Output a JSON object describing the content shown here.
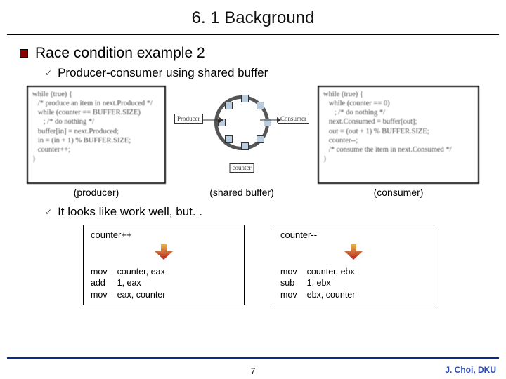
{
  "title": "6. 1 Background",
  "heading": "Race condition example 2",
  "sub1": "Producer-consumer using shared buffer",
  "producer_code": "while (true) {\n   /* produce an item in next.Produced */\n   while (counter == BUFFER.SIZE)\n      ; /* do nothing */\n   buffer[in] = next.Produced;\n   in = (in + 1) % BUFFER.SIZE;\n   counter++;\n}",
  "consumer_code": "while (true) {\n   while (counter == 0)\n      ; /* do nothing */\n   next.Consumed = buffer[out];\n   out = (out + 1) % BUFFER.SIZE;\n   counter--;\n   /* consume the item in next.Consumed */\n}",
  "diagram": {
    "producer_box": "Producer",
    "consumer_box": "Consumer",
    "counter_box": "counter"
  },
  "labels": {
    "producer": "(producer)",
    "shared": "(shared buffer)",
    "consumer": "(consumer)"
  },
  "sub2": "It looks like work well, but. .",
  "asm_left": {
    "title": "counter++",
    "ops": "mov\nadd\nmov",
    "args": "counter, eax\n1, eax\neax, counter"
  },
  "asm_right": {
    "title": "counter--",
    "ops": "mov\nsub\nmov",
    "args": "counter, ebx\n1, ebx\nebx, counter"
  },
  "footer": "J. Choi, DKU",
  "page": "7"
}
